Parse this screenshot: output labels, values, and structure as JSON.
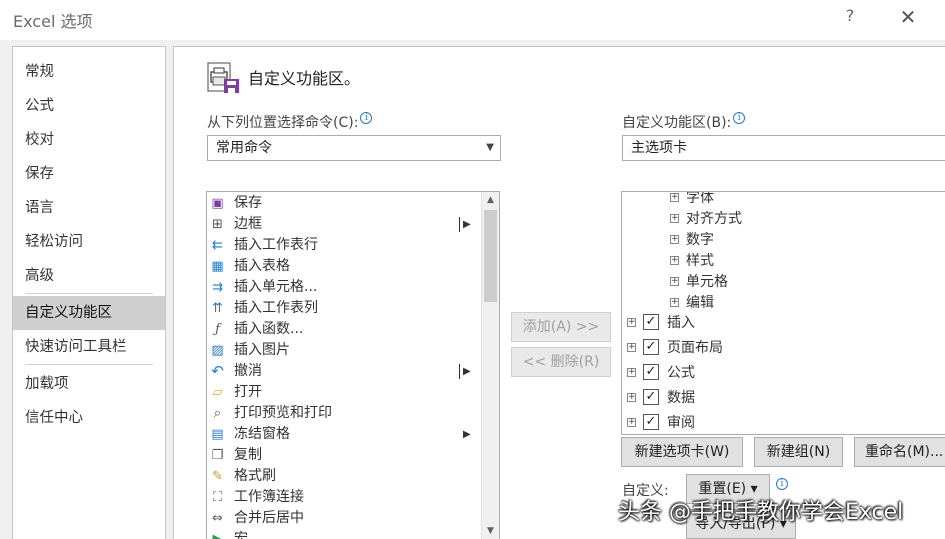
{
  "window": {
    "title": "Excel 选项",
    "help": "?",
    "close": "✕"
  },
  "nav": {
    "items": [
      {
        "label": "常规"
      },
      {
        "label": "公式"
      },
      {
        "label": "校对"
      },
      {
        "label": "保存"
      },
      {
        "label": "语言"
      },
      {
        "label": "轻松访问"
      },
      {
        "label": "高级"
      },
      {
        "label": "自定义功能区"
      },
      {
        "label": "快速访问工具栏"
      },
      {
        "label": "加载项"
      },
      {
        "label": "信任中心"
      }
    ],
    "active_index": 7
  },
  "main": {
    "heading": "自定义功能区。",
    "choose_label": "从下列位置选择命令(C):",
    "choose_value": "常用命令",
    "ribbon_label": "自定义功能区(B):",
    "ribbon_value": "主选项卡",
    "commands": [
      {
        "label": "保存",
        "icon": "save-icon",
        "glyph": "▣",
        "submenu": false
      },
      {
        "label": "边框",
        "icon": "borders-icon",
        "glyph": "⊞",
        "submenu": true
      },
      {
        "label": "插入工作表行",
        "icon": "insert-rows-icon",
        "glyph": "⇇",
        "submenu": false
      },
      {
        "label": "插入表格",
        "icon": "insert-table-icon",
        "glyph": "▦",
        "submenu": false
      },
      {
        "label": "插入单元格...",
        "icon": "insert-cells-icon",
        "glyph": "⇉",
        "submenu": false
      },
      {
        "label": "插入工作表列",
        "icon": "insert-columns-icon",
        "glyph": "⇈",
        "submenu": false
      },
      {
        "label": "插入函数...",
        "icon": "function-icon",
        "glyph": "ƒ",
        "submenu": false
      },
      {
        "label": "插入图片",
        "icon": "picture-icon",
        "glyph": "▨",
        "submenu": false
      },
      {
        "label": "撤消",
        "icon": "undo-icon",
        "glyph": "↶",
        "submenu": true
      },
      {
        "label": "打开",
        "icon": "folder-icon",
        "glyph": "▱",
        "submenu": false
      },
      {
        "label": "打印预览和打印",
        "icon": "print-preview-icon",
        "glyph": "⌕",
        "submenu": false
      },
      {
        "label": "冻结窗格",
        "icon": "freeze-panes-icon",
        "glyph": "▤",
        "submenu": true
      },
      {
        "label": "复制",
        "icon": "copy-icon",
        "glyph": "❐",
        "submenu": false
      },
      {
        "label": "格式刷",
        "icon": "format-painter-icon",
        "glyph": "✎",
        "submenu": false
      },
      {
        "label": "工作簿连接",
        "icon": "connections-icon",
        "glyph": "⛶",
        "submenu": false
      },
      {
        "label": "合并后居中",
        "icon": "merge-center-icon",
        "glyph": "⇔",
        "submenu": false
      },
      {
        "label": "宏",
        "icon": "macro-icon",
        "glyph": "▶",
        "submenu": false
      }
    ],
    "add_button": "添加(A) >>",
    "remove_button": "<< 删除(R)",
    "tree": [
      {
        "label": "字体",
        "level": 2,
        "checkbox": false
      },
      {
        "label": "对齐方式",
        "level": 2,
        "checkbox": false
      },
      {
        "label": "数字",
        "level": 2,
        "checkbox": false
      },
      {
        "label": "样式",
        "level": 2,
        "checkbox": false
      },
      {
        "label": "单元格",
        "level": 2,
        "checkbox": false
      },
      {
        "label": "编辑",
        "level": 2,
        "checkbox": false
      },
      {
        "label": "插入",
        "level": 1,
        "checkbox": true
      },
      {
        "label": "页面布局",
        "level": 1,
        "checkbox": true
      },
      {
        "label": "公式",
        "level": 1,
        "checkbox": true
      },
      {
        "label": "数据",
        "level": 1,
        "checkbox": true
      },
      {
        "label": "审阅",
        "level": 1,
        "checkbox": true
      }
    ],
    "new_tab_button": "新建选项卡(W)",
    "new_group_button": "新建组(N)",
    "rename_button": "重命名(M)...",
    "customize_label": "自定义:",
    "reset_button": "重置(E) ▾",
    "import_export_button": "导入/导出(P) ▾"
  },
  "watermark": "头条 @手把手教你学会Excel"
}
